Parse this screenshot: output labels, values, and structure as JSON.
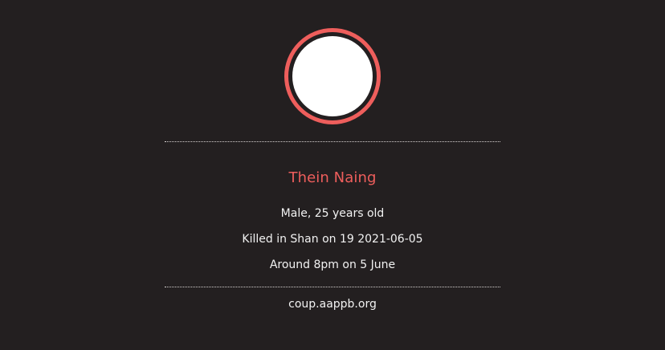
{
  "profile": {
    "name": "Thein Naing",
    "details": [
      "Male, 25 years old",
      "Killed in Shan on 19 2021-06-05",
      "Around 8pm on 5 June"
    ],
    "source": "coup.aappb.org"
  },
  "colors": {
    "background": "#231f20",
    "accent": "#ee5e5c",
    "text": "#f2f2f2",
    "photo_placeholder": "#ffffff"
  }
}
